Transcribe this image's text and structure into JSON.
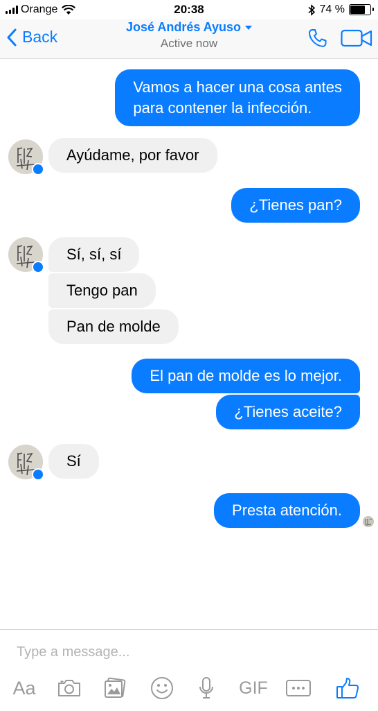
{
  "status_bar": {
    "carrier": "Orange",
    "time": "20:38",
    "battery": "74 %",
    "battery_level": 0.74
  },
  "header": {
    "back_label": "Back",
    "contact_name": "José Andrés Ayuso",
    "contact_status": "Active now",
    "accent_color": "#0a7cff",
    "icons": [
      "chevron-left-icon",
      "chevron-down-icon",
      "phone-icon",
      "video-camera-icon"
    ]
  },
  "messages": [
    {
      "from": "me",
      "lines": [
        "Vamos a hacer una cosa antes",
        "para contener la infección."
      ]
    },
    {
      "from": "them",
      "text": "Ayúdame, por favor"
    },
    {
      "from": "me",
      "text": "¿Tienes pan?"
    },
    {
      "from": "them",
      "text": "Sí, sí, sí"
    },
    {
      "from": "them",
      "text": "Tengo pan"
    },
    {
      "from": "them",
      "text": "Pan de molde"
    },
    {
      "from": "me",
      "text": "El pan de molde es lo mejor."
    },
    {
      "from": "me",
      "text": "¿Tienes aceite?"
    },
    {
      "from": "them",
      "text": "Sí"
    },
    {
      "from": "me",
      "text": "Presta atención."
    }
  ],
  "composer": {
    "placeholder": "Type a message...",
    "aa_label": "Aa",
    "gif_label": "GIF",
    "icons": [
      "camera-icon",
      "image-icon",
      "emoji-icon",
      "microphone-icon",
      "more-icon",
      "thumbs-up-icon"
    ]
  },
  "colors": {
    "outgoing_bubble": "#0a7cff",
    "incoming_bubble": "#f1f0f0"
  }
}
